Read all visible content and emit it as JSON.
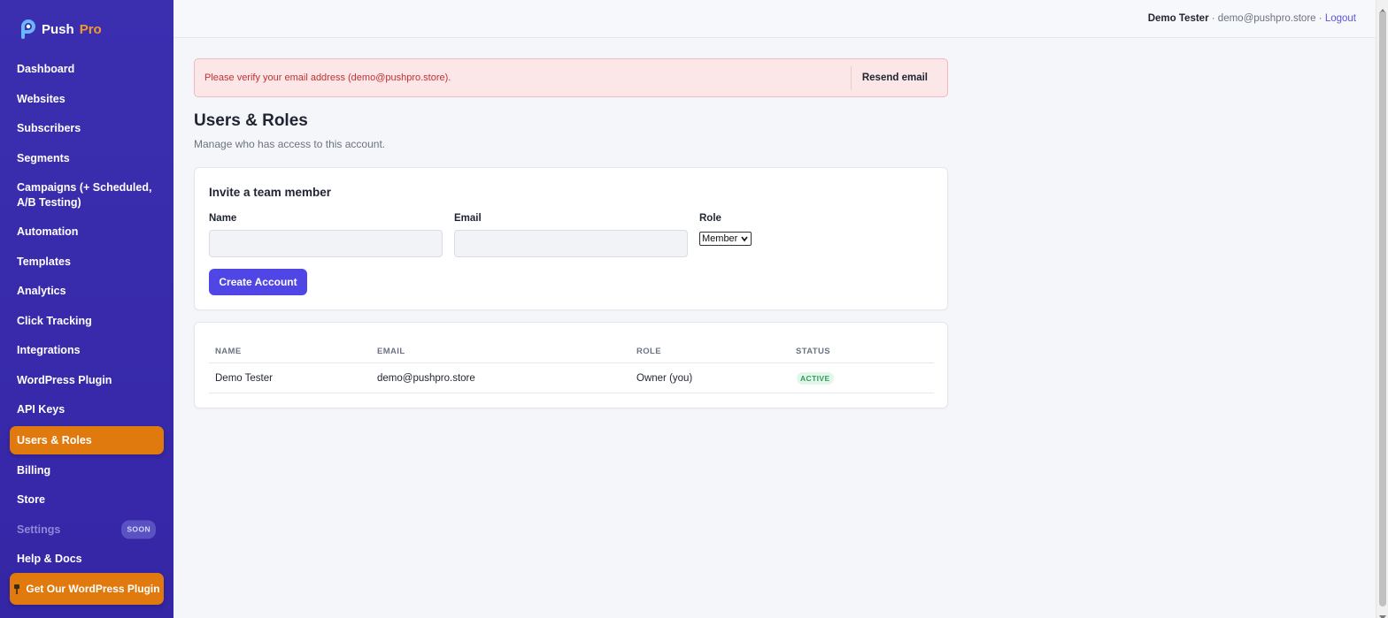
{
  "brand": {
    "name": "Push",
    "accent": "Pro",
    "accent_color": "#f39a2b",
    "sidebar_color": "#3b2fb0",
    "active_color": "#e07a0e"
  },
  "sidebar": {
    "items": [
      {
        "label": "Dashboard"
      },
      {
        "label": "Websites"
      },
      {
        "label": "Subscribers"
      },
      {
        "label": "Segments"
      },
      {
        "label": "Campaigns (+ Scheduled, A/B Testing)"
      },
      {
        "label": "Automation"
      },
      {
        "label": "Templates"
      },
      {
        "label": "Analytics"
      },
      {
        "label": "Click Tracking"
      },
      {
        "label": "Integrations"
      },
      {
        "label": "WordPress Plugin"
      },
      {
        "label": "API Keys"
      },
      {
        "label": "Users & Roles",
        "active": true
      },
      {
        "label": "Billing"
      },
      {
        "label": "Store"
      },
      {
        "label": "Settings",
        "disabled": true,
        "badge": "SOON"
      },
      {
        "label": "Help & Docs"
      }
    ],
    "promo": {
      "label": "Get Our WordPress Plugin",
      "icon": "pin-icon"
    }
  },
  "header": {
    "user_name": "Demo Tester",
    "separator": "·",
    "user_email": "demo@pushpro.store",
    "logout_label": "Logout"
  },
  "alert": {
    "message": "Please verify your email address (demo@pushpro.store).",
    "button_label": "Resend email"
  },
  "page": {
    "title": "Users & Roles",
    "subtitle": "Manage who has access to this account."
  },
  "invite": {
    "title": "Invite a team member",
    "name_label": "Name",
    "name_value": "",
    "email_label": "Email",
    "email_value": "",
    "role_label": "Role",
    "role_value": "Member",
    "submit_label": "Create Account"
  },
  "users_table": {
    "columns": [
      "NAME",
      "EMAIL",
      "ROLE",
      "STATUS"
    ],
    "rows": [
      {
        "name": "Demo Tester",
        "email": "demo@pushpro.store",
        "role": "Owner (you)",
        "status": "ACTIVE"
      }
    ]
  }
}
